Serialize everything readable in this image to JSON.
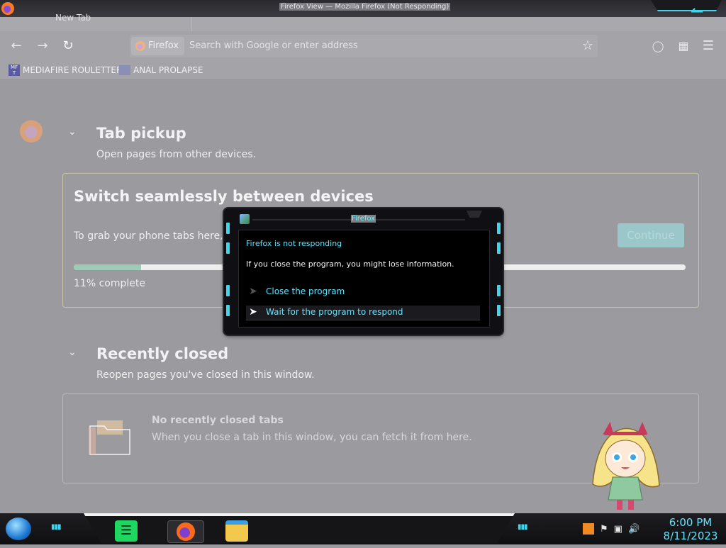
{
  "window": {
    "title": "Firefox View — Mozilla Firefox (Not Responding)"
  },
  "tab": {
    "label": "New Tab"
  },
  "navbar": {
    "identity_label": "Firefox",
    "search_placeholder": "Search with Google or enter address"
  },
  "bookmarks": [
    {
      "label": "MEDIAFIRE ROULETTER",
      "favicon": "MF T"
    },
    {
      "label": "ANAL PROLAPSE"
    }
  ],
  "tab_pickup": {
    "title": "Tab pickup",
    "subtitle": "Open pages from other devices.",
    "card_title": "Switch seamlessly between devices",
    "card_desc": "To grab your phone tabs here, fi",
    "continue_label": "Continue",
    "progress": 0.11,
    "progress_text": "11% complete"
  },
  "recently_closed": {
    "title": "Recently closed",
    "subtitle": "Reopen pages you've closed in this window.",
    "empty_title": "No recently closed tabs",
    "empty_desc": "When you close a tab in this window, you can fetch it from here."
  },
  "dialog": {
    "title": "Firefox",
    "heading": "Firefox is not responding",
    "message": "If you close the program, you might lose information.",
    "option_close": "Close the program",
    "option_wait": "Wait for the program to respond"
  },
  "taskbar": {
    "time": "6:00 PM",
    "date": "8/11/2023"
  },
  "colors": {
    "accent": "#5fe6ff",
    "progress_fill": "#9ecab7",
    "dialog_bg": "#000000"
  }
}
